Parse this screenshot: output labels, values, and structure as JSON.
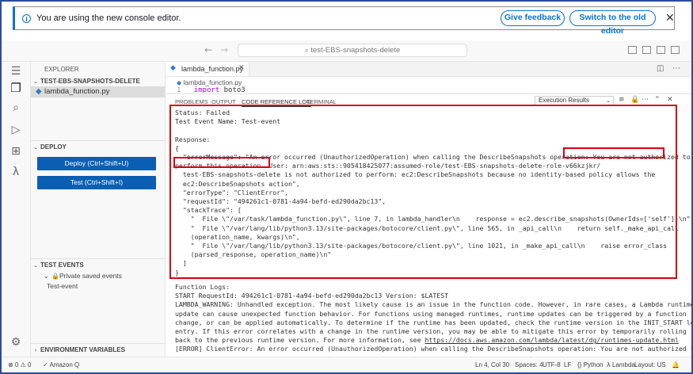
{
  "banner": {
    "message": "You are using the new console editor.",
    "feedback_label": "Give feedback",
    "switch_label": "Switch to the old editor"
  },
  "titlebar": {
    "command_center": "test-EBS-snapshots-delete"
  },
  "sidebar": {
    "header": "EXPLORER",
    "project": "TEST-EBS-SNAPSHOTS-DELETE",
    "file": "lambda_function.py",
    "deploy_section": "DEPLOY",
    "deploy_button": "Deploy (Ctrl+Shift+U)",
    "test_button": "Test (Ctrl+Shift+I)",
    "test_events_section": "TEST EVENTS",
    "private_events": "Private saved events",
    "test_event": "Test-event",
    "env_section": "ENVIRONMENT VARIABLES"
  },
  "editor": {
    "tab_label": "lambda_function.py",
    "breadcrumb": "lambda_function.py",
    "line_number": "1",
    "code_keyword": "import",
    "code_text": "boto3"
  },
  "panel": {
    "tabs": [
      "PROBLEMS",
      "OUTPUT",
      "CODE REFERENCE LOG",
      "TERMINAL"
    ],
    "select_value": "Execution Results",
    "status_line": "Status: Failed",
    "event_line": "Test Event Name: Test-event",
    "response_label": "Response:",
    "open_brace": "{",
    "error_msg_1": "  \"errorMessage\": \"An error occurred (UnauthorizedOperation) when calling the DescribeSnapshots operation: You are not authorized to",
    "error_msg_2": "perform this operation. User: arn:aws:sts::905418425077:assumed-role/test-EBS-snapshots-delete-role-v66kzjkr/",
    "error_msg_3": "  test-EBS-snapshots-delete is not authorized to perform: ec2:DescribeSnapshots because no identity-based policy allows the",
    "error_msg_4": "  ec2:DescribeSnapshots action\",",
    "error_type": "  \"errorType\": \"ClientError\",",
    "request_id": "  \"requestId\": \"494261c1-0781-4a94-befd-ed290da2bc13\",",
    "stack_open": "  \"stackTrace\": [",
    "stack_1": "    \"  File \\\"/var/task/lambda_function.py\\\", line 7, in lambda_handler\\n    response = ec2.describe_snapshots(OwnerIds=['self'])\\n\",",
    "stack_2a": "    \"  File \\\"/var/lang/lib/python3.13/site-packages/botocore/client.py\\\", line 565, in _api_call\\n    return self._make_api_call",
    "stack_2b": "    (operation_name, kwargs)\\n\",",
    "stack_3a": "    \"  File \\\"/var/lang/lib/python3.13/site-packages/botocore/client.py\\\", line 1021, in _make_api_call\\n    raise error_class",
    "stack_3b": "    (parsed_response, operation_name)\\n\"",
    "stack_close": "  ]",
    "close_brace": "}",
    "logs_label": "Function Logs:",
    "log_1": "START RequestId: 494261c1-0781-4a94-befd-ed290da2bc13 Version: $LATEST",
    "log_2": "LAMBDA_WARNING: Unhandled exception. The most likely cause is an issue in the function code. However, in rare cases, a Lambda runtime",
    "log_3": "update can cause unexpected function behavior. For functions using managed runtimes, runtime updates can be triggered by a function",
    "log_4": "change, or can be applied automatically. To determine if the runtime has been updated, check the runtime version in the INIT_START log",
    "log_5": "entry. If this error correlates with a change in the runtime version, you may be able to mitigate this error by temporarily rolling",
    "log_6_prefix": "back to the previous runtime version. For more information, see ",
    "log_6_link": "https://docs.aws.amazon.com/lambda/latest/dg/runtimes-update.html",
    "log_7": "[ERROR] ClientError: An error occurred (UnauthorizedOperation) when calling the DescribeSnapshots operation: You are not authorized to"
  },
  "statusbar": {
    "errors": "0",
    "warnings": "0",
    "amazon_q": "Amazon Q",
    "cursor": "Ln 4, Col 30",
    "spaces": "Spaces: 4",
    "encoding": "UTF-8",
    "eol": "LF",
    "language": "Python",
    "lambda": "Lambda",
    "layout": "Layout: US"
  },
  "colors": {
    "accent": "#0972d3",
    "button": "#0a5fb4",
    "highlight": "#d9000d"
  }
}
